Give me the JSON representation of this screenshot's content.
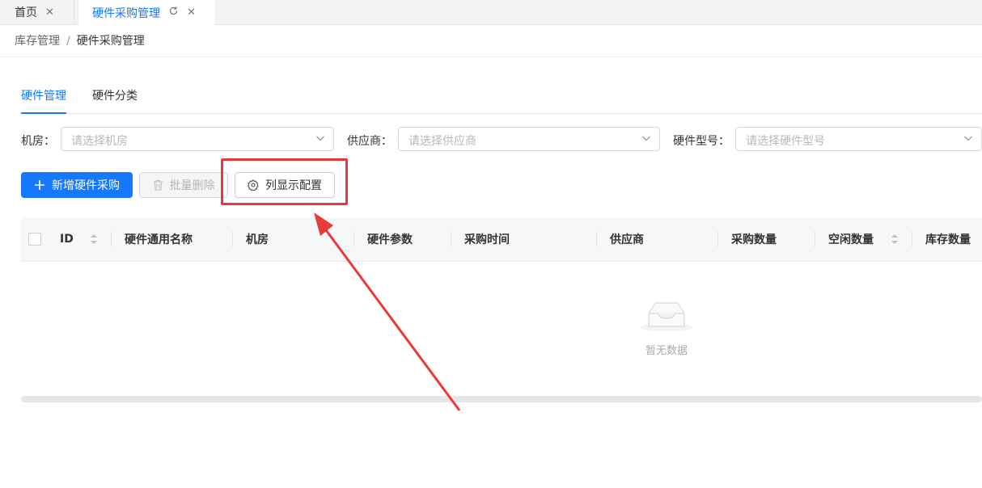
{
  "tabs": [
    {
      "label": "首页",
      "active": false
    },
    {
      "label": "硬件采购管理",
      "active": true
    }
  ],
  "breadcrumb": {
    "parent": "库存管理",
    "separator": "/",
    "current": "硬件采购管理"
  },
  "subtabs": [
    {
      "label": "硬件管理",
      "active": true
    },
    {
      "label": "硬件分类",
      "active": false
    }
  ],
  "filters": [
    {
      "label": "机房：",
      "placeholder": "请选择机房"
    },
    {
      "label": "供应商：",
      "placeholder": "请选择供应商"
    },
    {
      "label": "硬件型号：",
      "placeholder": "请选择硬件型号"
    }
  ],
  "actions": {
    "add_label": "新增硬件采购",
    "batch_delete_label": "批量删除",
    "column_config_label": "列显示配置"
  },
  "table": {
    "columns": [
      "ID",
      "硬件通用名称",
      "机房",
      "硬件参数",
      "采购时间",
      "供应商",
      "采购数量",
      "空闲数量",
      "库存数量"
    ],
    "rows": [],
    "empty_text": "暂无数据"
  },
  "colors": {
    "accent": "#1677ff",
    "annotation": "#e83a37"
  },
  "icons": {
    "tab_close": "close-icon",
    "tab_refresh": "refresh-icon",
    "select_arrow": "chevron-down-icon",
    "add": "plus-icon",
    "delete": "trash-icon",
    "settings": "gear-icon",
    "sort": "sort-icon",
    "empty": "inbox-icon"
  }
}
